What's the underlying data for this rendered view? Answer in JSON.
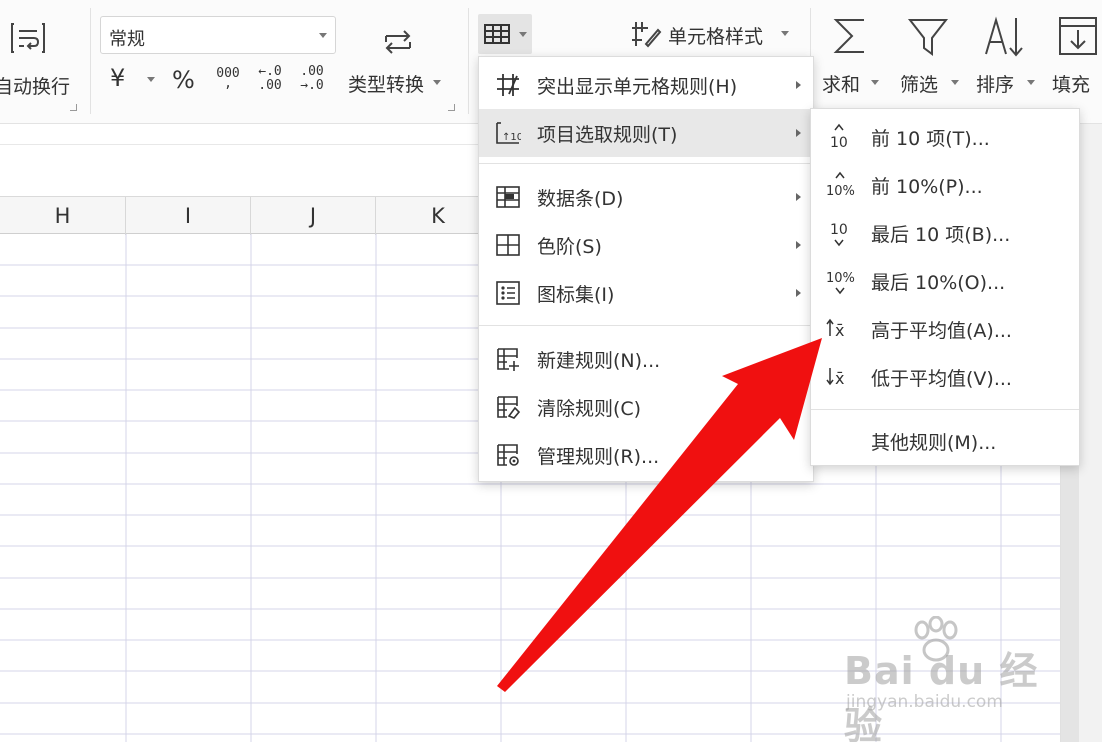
{
  "ribbon": {
    "wrap_text_label": "自动换行",
    "number_format_value": "常规",
    "currency_symbol": "¥",
    "percent_symbol": "%",
    "thousands_symbol": "000",
    "decrease_decimal_top": "←.0",
    "decrease_decimal_bottom": ".00",
    "increase_decimal_top": ".00",
    "increase_decimal_bottom": "→.0",
    "type_convert_label": "类型转换",
    "cell_style_label": "单元格样式",
    "sum_label": "求和",
    "filter_label": "筛选",
    "sort_label": "排序",
    "fill_label": "填充"
  },
  "sheet": {
    "columns": [
      "H",
      "I",
      "J",
      "K"
    ]
  },
  "cf_menu": {
    "items": [
      {
        "label": "突出显示单元格规则(H)",
        "icon": "highlight-rules-icon",
        "submenu": true
      },
      {
        "label": "项目选取规则(T)",
        "icon": "top-bottom-rules-icon",
        "submenu": true
      },
      {
        "label": "数据条(D)",
        "icon": "data-bars-icon",
        "submenu": true
      },
      {
        "label": "色阶(S)",
        "icon": "color-scales-icon",
        "submenu": true
      },
      {
        "label": "图标集(I)",
        "icon": "icon-sets-icon",
        "submenu": true
      },
      {
        "label": "新建规则(N)...",
        "icon": "new-rule-icon",
        "submenu": false
      },
      {
        "label": "清除规则(C)",
        "icon": "clear-rules-icon",
        "submenu": false
      },
      {
        "label": "管理规则(R)...",
        "icon": "manage-rules-icon",
        "submenu": false
      }
    ]
  },
  "submenu": {
    "items": [
      {
        "label": "前 10 项(T)...",
        "icon_text": "10"
      },
      {
        "label": "前 10%(P)...",
        "icon_text": "10%"
      },
      {
        "label": "最后 10 项(B)...",
        "icon_text": "10"
      },
      {
        "label": "最后 10%(O)...",
        "icon_text": "10%"
      },
      {
        "label": "高于平均值(A)...",
        "icon_text": "x̄"
      },
      {
        "label": "低于平均值(V)...",
        "icon_text": "x̄"
      },
      {
        "label": "其他规则(M)..."
      }
    ]
  },
  "watermark": {
    "logo": "Bai du 经验",
    "url": "jingyan.baidu.com"
  },
  "colors": {
    "arrow": "#f01010",
    "grid_line": "#d4d4e8",
    "menu_highlight": "#e8e8e8"
  }
}
